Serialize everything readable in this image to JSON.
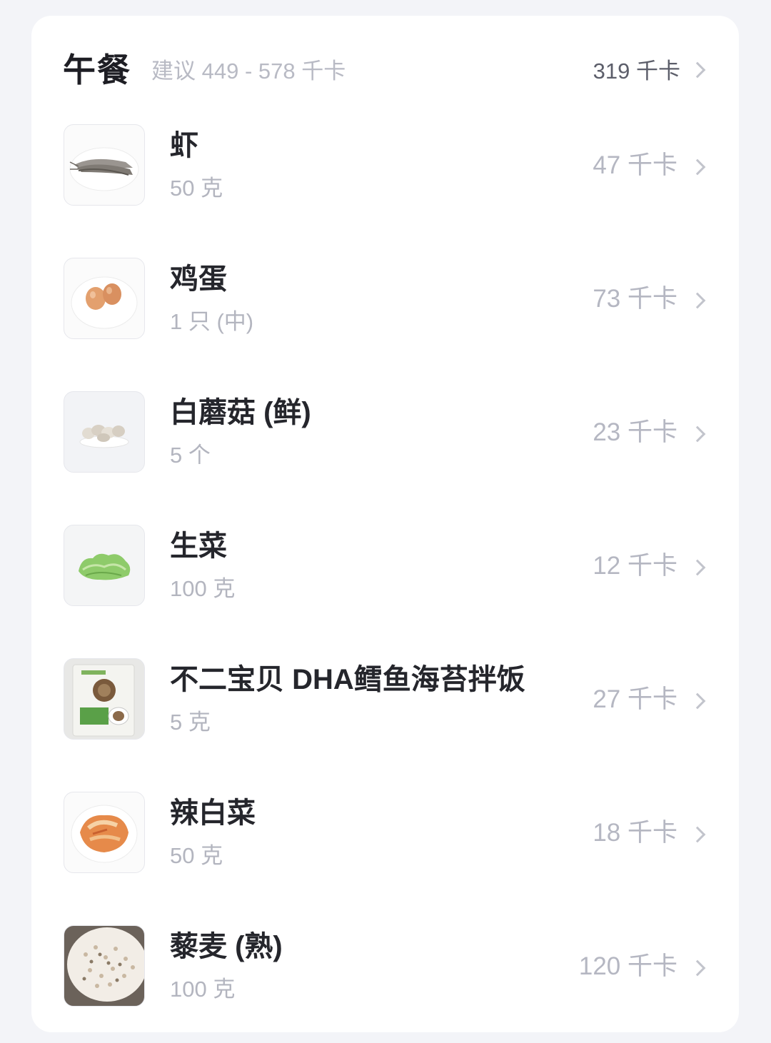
{
  "meal": {
    "title": "午餐",
    "suggestion": "建议 449 - 578 千卡",
    "total": "319 千卡"
  },
  "items": [
    {
      "name": "虾",
      "amount": "50 克",
      "kcal": "47 千卡",
      "image": "shrimp-plate"
    },
    {
      "name": "鸡蛋",
      "amount": "1 只 (中)",
      "kcal": "73 千卡",
      "image": "eggs-plate"
    },
    {
      "name": "白蘑菇 (鲜)",
      "amount": "5 个",
      "kcal": "23 千卡",
      "image": "mushrooms-plate"
    },
    {
      "name": "生菜",
      "amount": "100 克",
      "kcal": "12 千卡",
      "image": "lettuce"
    },
    {
      "name": "不二宝贝 DHA鳕鱼海苔拌饭",
      "amount": "5 克",
      "kcal": "27 千卡",
      "image": "seaweed-package"
    },
    {
      "name": "辣白菜",
      "amount": "50 克",
      "kcal": "18 千卡",
      "image": "kimchi-plate"
    },
    {
      "name": "藜麦 (熟)",
      "amount": "100 克",
      "kcal": "120 千卡",
      "image": "quinoa-plate"
    }
  ]
}
